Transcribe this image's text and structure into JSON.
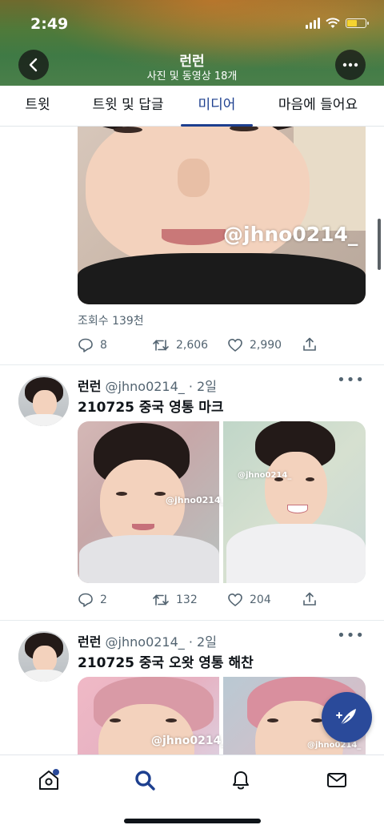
{
  "status_bar": {
    "time": "2:49"
  },
  "header": {
    "title": "런런",
    "subtitle": "사진 및 동영상 18개"
  },
  "tabs": [
    {
      "label": "트윗",
      "active": false
    },
    {
      "label": "트윗 및 답글",
      "active": false
    },
    {
      "label": "미디어",
      "active": true
    },
    {
      "label": "마음에 들어요",
      "active": false
    }
  ],
  "tweets": [
    {
      "watermark": "@jhno0214_",
      "views": "조회수 139천",
      "replies": "8",
      "retweets": "2,606",
      "likes": "2,990"
    },
    {
      "name": "런런",
      "handle": "@jhno0214_",
      "time": "· 2일",
      "text": "210725 중국 영통 마크",
      "watermark_left": "@jhno0214_",
      "watermark_right": "@jhno0214_",
      "replies": "2",
      "retweets": "132",
      "likes": "204"
    },
    {
      "name": "런런",
      "handle": "@jhno0214_",
      "time": "· 2일",
      "text": "210725 중국 오왓 영통 해찬",
      "watermark_left": "@jhno0214_",
      "watermark_right": "@jhno0214_"
    }
  ],
  "colors": {
    "accent": "#1d3f8f",
    "fab": "#2a4a9a",
    "secondary_text": "#536471"
  },
  "icons": {
    "back": "chevron-left-icon",
    "more": "more-horizontal-icon",
    "reply": "reply-icon",
    "retweet": "retweet-icon",
    "like": "heart-icon",
    "share": "share-icon",
    "compose": "compose-feather-icon",
    "nav": [
      "home-icon",
      "search-icon",
      "bell-icon",
      "mail-icon"
    ]
  }
}
